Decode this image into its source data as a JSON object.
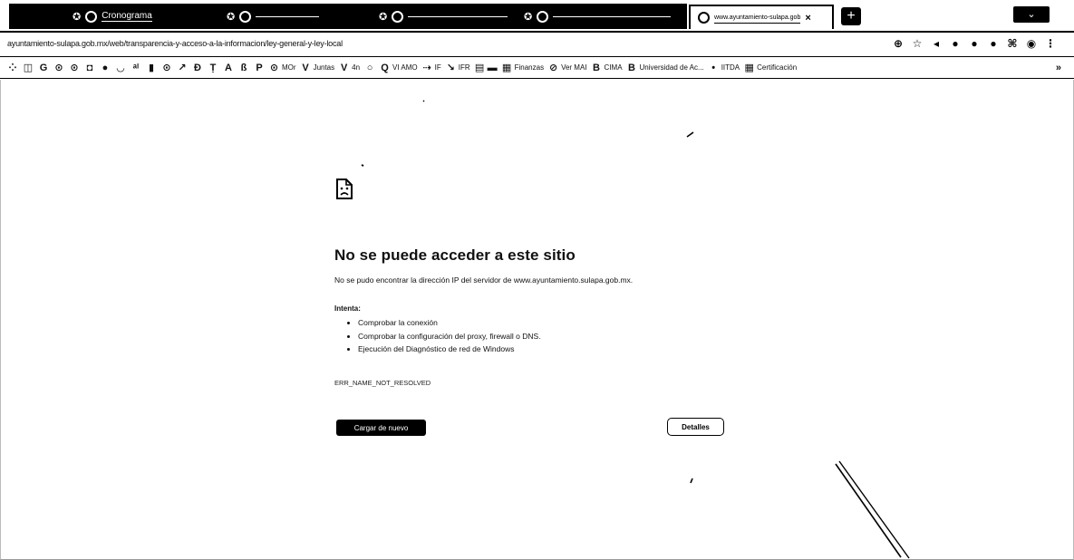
{
  "tabs": [
    {
      "label": "Cronograma",
      "active": false
    },
    {
      "label": "",
      "active": false
    },
    {
      "label": "",
      "active": false
    },
    {
      "label": "",
      "active": false
    },
    {
      "label": "www.ayuntamiento-sulapa.gob",
      "active": true
    }
  ],
  "address_bar": {
    "url": "ayuntamiento-sulapa.gob.mx/web/transparencia-y-acceso-a-la-informacion/ley-general-y-ley-local"
  },
  "bookmarks": [
    {
      "label": "MOr",
      "icon": "globe-icon"
    },
    {
      "label": "Juntas",
      "icon": "v-icon"
    },
    {
      "label": "4n",
      "icon": "v-icon"
    },
    {
      "label": "VI AMO",
      "icon": "q-icon"
    },
    {
      "label": "IF",
      "icon": "link-icon"
    },
    {
      "label": "IFR",
      "icon": "link-icon"
    },
    {
      "label": "",
      "icon": "page-icon"
    },
    {
      "label": "Finanzas",
      "icon": "calendar-icon"
    },
    {
      "label": "Ver MAI",
      "icon": "globe-icon"
    },
    {
      "label": "CIMA",
      "icon": "b-icon"
    },
    {
      "label": "Universidad de Ac...",
      "icon": "b-icon"
    },
    {
      "label": "IITDA",
      "icon": "dot-icon"
    },
    {
      "label": "Certificación",
      "icon": "calendar-icon"
    }
  ],
  "error": {
    "title": "No se puede acceder a este sitio",
    "description": "No se pudo encontrar la dirección IP del servidor de www.ayuntamiento.sulapa.gob.mx.",
    "try_label": "Intenta:",
    "suggestions": [
      "Comprobar la conexión",
      "Comprobar la configuración del proxy, firewall o DNS.",
      "Ejecución del Diagnóstico de red de Windows"
    ],
    "code": "ERR_NAME_NOT_RESOLVED",
    "reload_button": "Cargar de nuevo",
    "details_button": "Detalles"
  }
}
